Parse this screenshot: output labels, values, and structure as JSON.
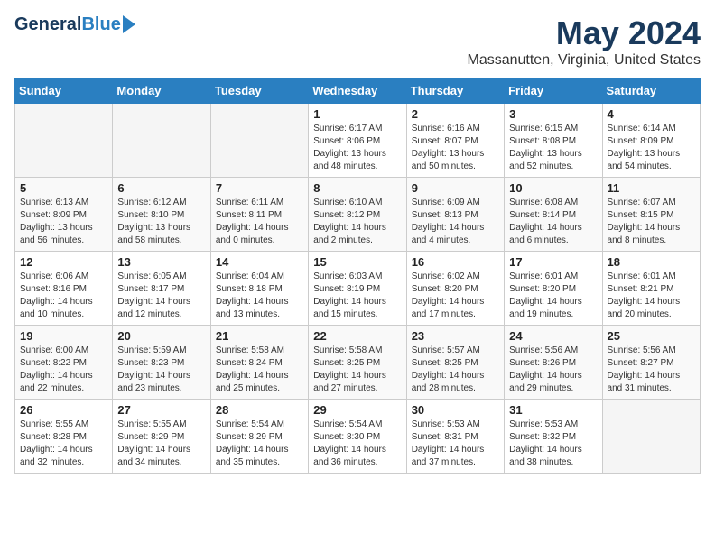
{
  "header": {
    "logo_general": "General",
    "logo_blue": "Blue",
    "title": "May 2024",
    "subtitle": "Massanutten, Virginia, United States"
  },
  "days_of_week": [
    "Sunday",
    "Monday",
    "Tuesday",
    "Wednesday",
    "Thursday",
    "Friday",
    "Saturday"
  ],
  "weeks": [
    [
      {
        "day": "",
        "info": ""
      },
      {
        "day": "",
        "info": ""
      },
      {
        "day": "",
        "info": ""
      },
      {
        "day": "1",
        "info": "Sunrise: 6:17 AM\nSunset: 8:06 PM\nDaylight: 13 hours\nand 48 minutes."
      },
      {
        "day": "2",
        "info": "Sunrise: 6:16 AM\nSunset: 8:07 PM\nDaylight: 13 hours\nand 50 minutes."
      },
      {
        "day": "3",
        "info": "Sunrise: 6:15 AM\nSunset: 8:08 PM\nDaylight: 13 hours\nand 52 minutes."
      },
      {
        "day": "4",
        "info": "Sunrise: 6:14 AM\nSunset: 8:09 PM\nDaylight: 13 hours\nand 54 minutes."
      }
    ],
    [
      {
        "day": "5",
        "info": "Sunrise: 6:13 AM\nSunset: 8:09 PM\nDaylight: 13 hours\nand 56 minutes."
      },
      {
        "day": "6",
        "info": "Sunrise: 6:12 AM\nSunset: 8:10 PM\nDaylight: 13 hours\nand 58 minutes."
      },
      {
        "day": "7",
        "info": "Sunrise: 6:11 AM\nSunset: 8:11 PM\nDaylight: 14 hours\nand 0 minutes."
      },
      {
        "day": "8",
        "info": "Sunrise: 6:10 AM\nSunset: 8:12 PM\nDaylight: 14 hours\nand 2 minutes."
      },
      {
        "day": "9",
        "info": "Sunrise: 6:09 AM\nSunset: 8:13 PM\nDaylight: 14 hours\nand 4 minutes."
      },
      {
        "day": "10",
        "info": "Sunrise: 6:08 AM\nSunset: 8:14 PM\nDaylight: 14 hours\nand 6 minutes."
      },
      {
        "day": "11",
        "info": "Sunrise: 6:07 AM\nSunset: 8:15 PM\nDaylight: 14 hours\nand 8 minutes."
      }
    ],
    [
      {
        "day": "12",
        "info": "Sunrise: 6:06 AM\nSunset: 8:16 PM\nDaylight: 14 hours\nand 10 minutes."
      },
      {
        "day": "13",
        "info": "Sunrise: 6:05 AM\nSunset: 8:17 PM\nDaylight: 14 hours\nand 12 minutes."
      },
      {
        "day": "14",
        "info": "Sunrise: 6:04 AM\nSunset: 8:18 PM\nDaylight: 14 hours\nand 13 minutes."
      },
      {
        "day": "15",
        "info": "Sunrise: 6:03 AM\nSunset: 8:19 PM\nDaylight: 14 hours\nand 15 minutes."
      },
      {
        "day": "16",
        "info": "Sunrise: 6:02 AM\nSunset: 8:20 PM\nDaylight: 14 hours\nand 17 minutes."
      },
      {
        "day": "17",
        "info": "Sunrise: 6:01 AM\nSunset: 8:20 PM\nDaylight: 14 hours\nand 19 minutes."
      },
      {
        "day": "18",
        "info": "Sunrise: 6:01 AM\nSunset: 8:21 PM\nDaylight: 14 hours\nand 20 minutes."
      }
    ],
    [
      {
        "day": "19",
        "info": "Sunrise: 6:00 AM\nSunset: 8:22 PM\nDaylight: 14 hours\nand 22 minutes."
      },
      {
        "day": "20",
        "info": "Sunrise: 5:59 AM\nSunset: 8:23 PM\nDaylight: 14 hours\nand 23 minutes."
      },
      {
        "day": "21",
        "info": "Sunrise: 5:58 AM\nSunset: 8:24 PM\nDaylight: 14 hours\nand 25 minutes."
      },
      {
        "day": "22",
        "info": "Sunrise: 5:58 AM\nSunset: 8:25 PM\nDaylight: 14 hours\nand 27 minutes."
      },
      {
        "day": "23",
        "info": "Sunrise: 5:57 AM\nSunset: 8:25 PM\nDaylight: 14 hours\nand 28 minutes."
      },
      {
        "day": "24",
        "info": "Sunrise: 5:56 AM\nSunset: 8:26 PM\nDaylight: 14 hours\nand 29 minutes."
      },
      {
        "day": "25",
        "info": "Sunrise: 5:56 AM\nSunset: 8:27 PM\nDaylight: 14 hours\nand 31 minutes."
      }
    ],
    [
      {
        "day": "26",
        "info": "Sunrise: 5:55 AM\nSunset: 8:28 PM\nDaylight: 14 hours\nand 32 minutes."
      },
      {
        "day": "27",
        "info": "Sunrise: 5:55 AM\nSunset: 8:29 PM\nDaylight: 14 hours\nand 34 minutes."
      },
      {
        "day": "28",
        "info": "Sunrise: 5:54 AM\nSunset: 8:29 PM\nDaylight: 14 hours\nand 35 minutes."
      },
      {
        "day": "29",
        "info": "Sunrise: 5:54 AM\nSunset: 8:30 PM\nDaylight: 14 hours\nand 36 minutes."
      },
      {
        "day": "30",
        "info": "Sunrise: 5:53 AM\nSunset: 8:31 PM\nDaylight: 14 hours\nand 37 minutes."
      },
      {
        "day": "31",
        "info": "Sunrise: 5:53 AM\nSunset: 8:32 PM\nDaylight: 14 hours\nand 38 minutes."
      },
      {
        "day": "",
        "info": ""
      }
    ]
  ]
}
